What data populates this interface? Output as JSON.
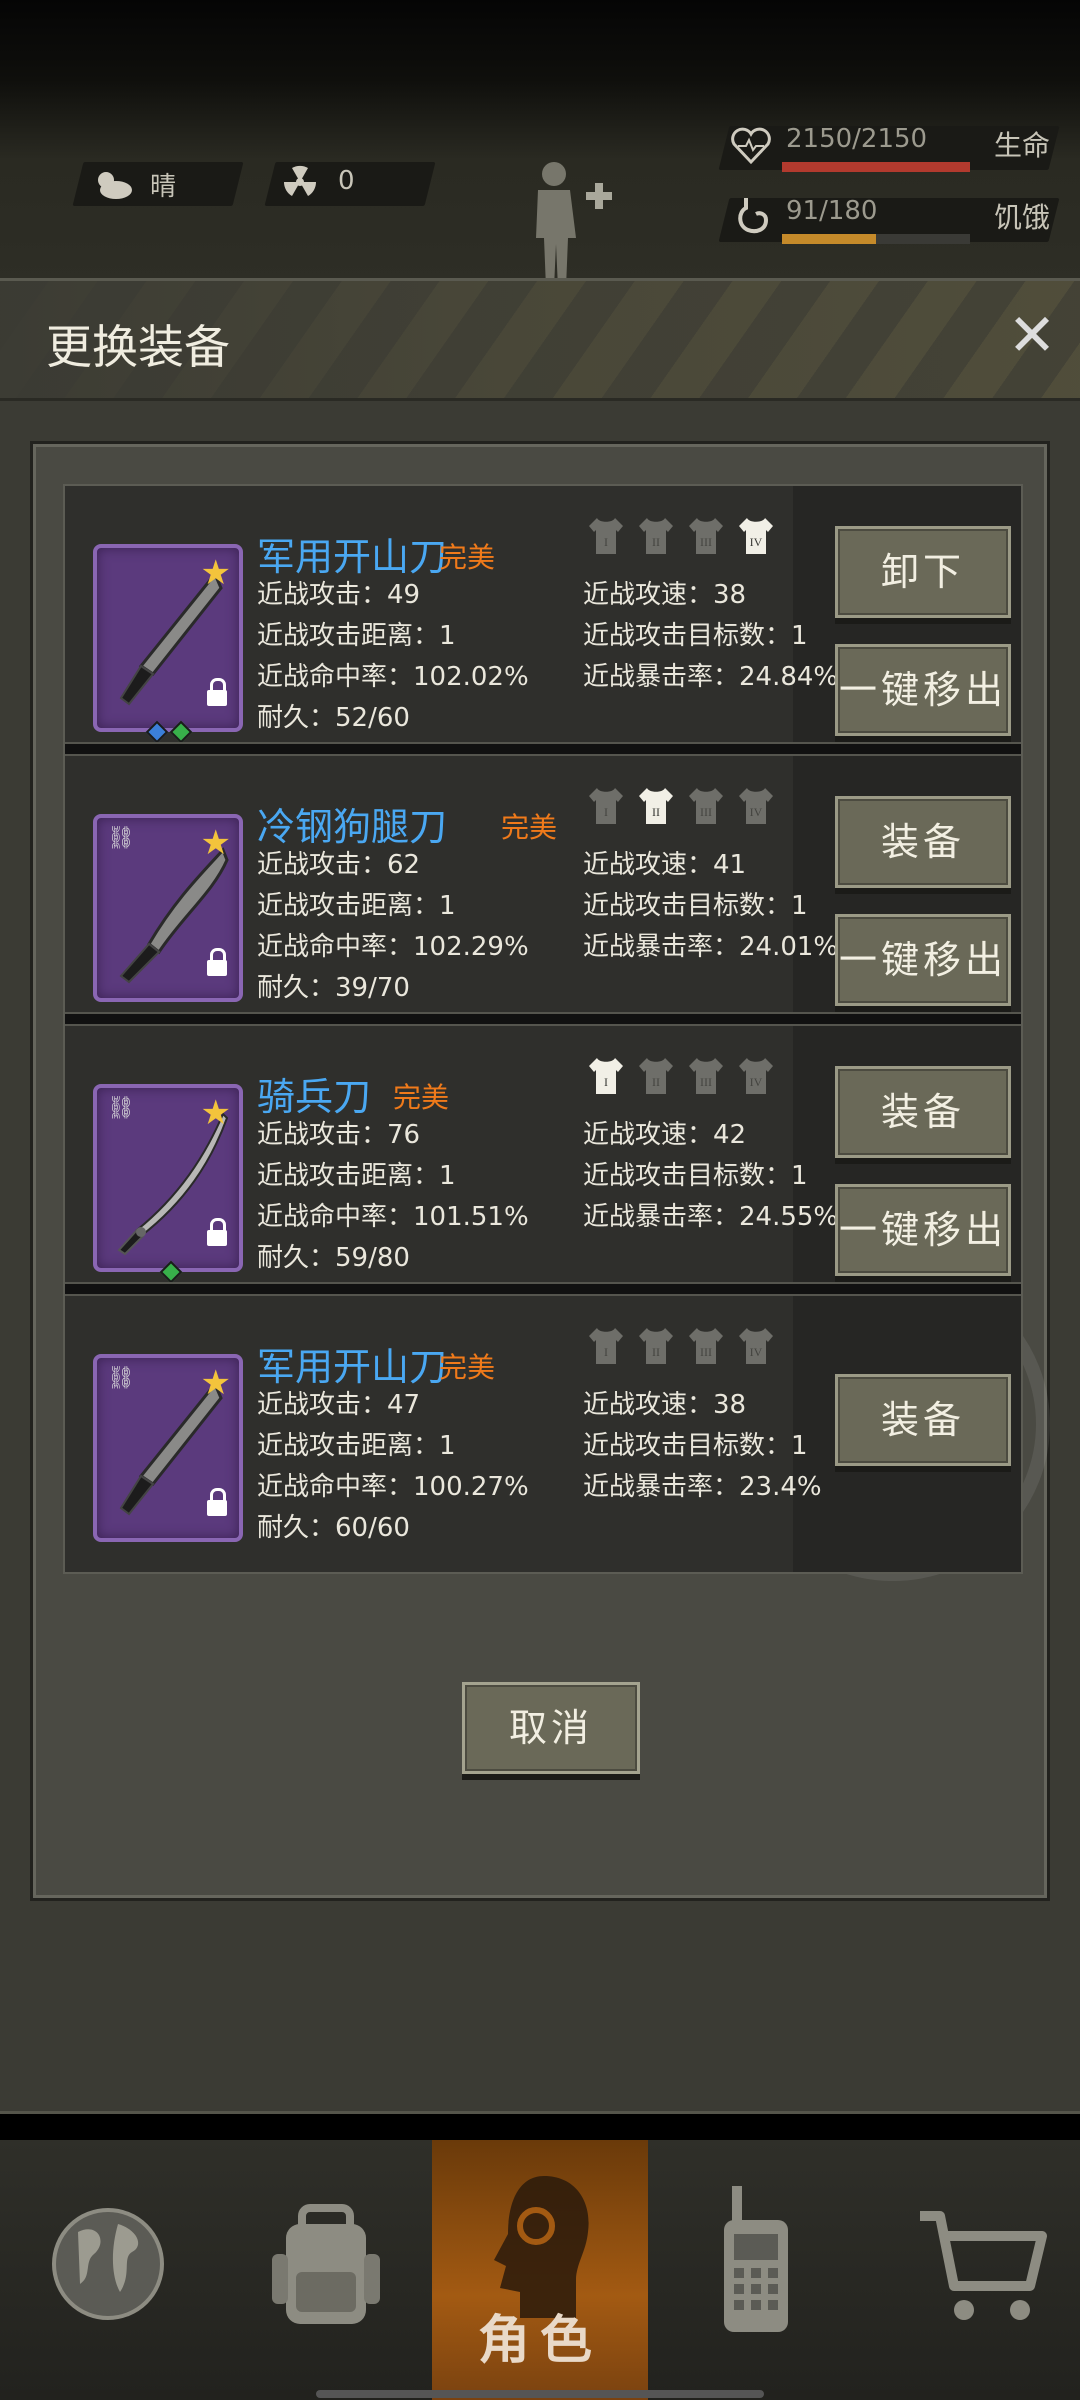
{
  "status": {
    "weather": "晴",
    "radiation": "0",
    "health": "2150/2150",
    "health_label": "生命",
    "health_fill": 1.0,
    "hunger": "91/180",
    "hunger_label": "饥饿",
    "hunger_fill": 0.5
  },
  "dialog": {
    "title": "更换装备",
    "cancel_label": "取消"
  },
  "labels": {
    "melee_attack": "近战攻击",
    "melee_range": "近战攻击距离",
    "melee_hit": "近战命中率",
    "durability": "耐久",
    "melee_speed": "近战攻速",
    "melee_targets": "近战攻击目标数",
    "melee_crit": "近战暴击率"
  },
  "items": [
    {
      "name": "军用开山刀",
      "quality": "完美",
      "attack": "近战攻击：49",
      "range": "近战攻击距离：1",
      "hit": "近战命中率：102.02%",
      "durability": "耐久：52/60",
      "speed": "近战攻速：38",
      "targets": "近战攻击目标数：1",
      "crit": "近战暴击率：24.84%",
      "active_slot": 4,
      "primary_btn": "卸下",
      "secondary_btn": "一键移出"
    },
    {
      "name": "冷钢狗腿刀",
      "quality": "完美",
      "attack": "近战攻击：62",
      "range": "近战攻击距离：1",
      "hit": "近战命中率：102.29%",
      "durability": "耐久：39/70",
      "speed": "近战攻速：41",
      "targets": "近战攻击目标数：1",
      "crit": "近战暴击率：24.01%",
      "active_slot": 2,
      "primary_btn": "装备",
      "secondary_btn": "一键移出"
    },
    {
      "name": "骑兵刀",
      "quality": "完美",
      "attack": "近战攻击：76",
      "range": "近战攻击距离：1",
      "hit": "近战命中率：101.51%",
      "durability": "耐久：59/80",
      "speed": "近战攻速：42",
      "targets": "近战攻击目标数：1",
      "crit": "近战暴击率：24.55%",
      "active_slot": 1,
      "primary_btn": "装备",
      "secondary_btn": "一键移出"
    },
    {
      "name": "军用开山刀",
      "quality": "完美",
      "attack": "近战攻击：47",
      "range": "近战攻击距离：1",
      "hit": "近战命中率：100.27%",
      "durability": "耐久：60/60",
      "speed": "近战攻速：38",
      "targets": "近战攻击目标数：1",
      "crit": "近战暴击率：23.4%",
      "active_slot": 0,
      "primary_btn": "装备",
      "secondary_btn": ""
    }
  ],
  "slots": [
    "I",
    "II",
    "III",
    "IV"
  ],
  "nav": {
    "active_label": "角色",
    "items": [
      "globe-icon",
      "backpack-icon",
      "character-icon",
      "radio-icon",
      "cart-icon"
    ]
  },
  "colors": {
    "name": "#4aa8f2",
    "quality": "#f07a1a",
    "frame": "#8a66b3",
    "accent": "#a35a12"
  }
}
